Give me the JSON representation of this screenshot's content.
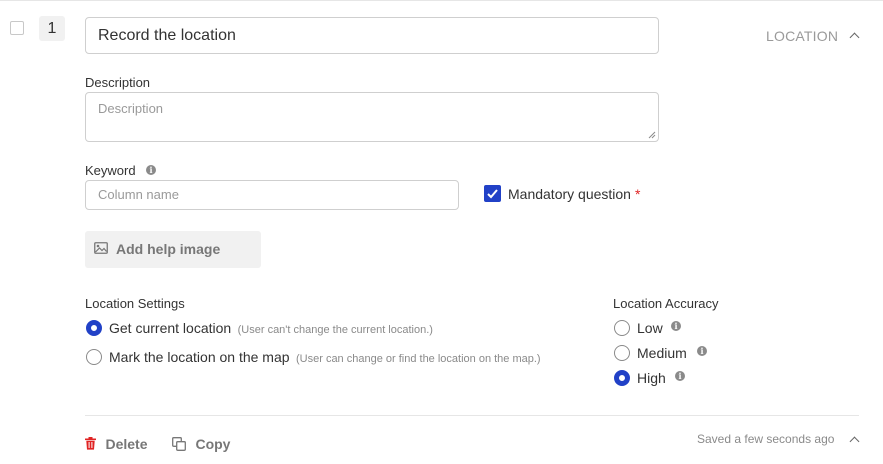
{
  "question": {
    "number": "1",
    "title": "Record the location",
    "type_label": "LOCATION"
  },
  "description": {
    "label": "Description",
    "placeholder": "Description"
  },
  "keyword": {
    "label": "Keyword",
    "placeholder": "Column name"
  },
  "mandatory": {
    "label": "Mandatory question",
    "required_mark": "*",
    "checked": true
  },
  "help_image": {
    "label": "Add help image"
  },
  "location_settings": {
    "label": "Location Settings",
    "options": [
      {
        "label": "Get current location",
        "hint": "(User can't change the current location.)",
        "selected": true
      },
      {
        "label": "Mark the location on the map",
        "hint": "(User can change or find the location on the map.)",
        "selected": false
      }
    ]
  },
  "location_accuracy": {
    "label": "Location Accuracy",
    "options": [
      {
        "label": "Low",
        "selected": false
      },
      {
        "label": "Medium",
        "selected": false
      },
      {
        "label": "High",
        "selected": true
      }
    ]
  },
  "footer": {
    "delete_label": "Delete",
    "copy_label": "Copy",
    "saved_status": "Saved a few seconds ago"
  },
  "colors": {
    "accent": "#2141c7",
    "required": "#e02424"
  }
}
